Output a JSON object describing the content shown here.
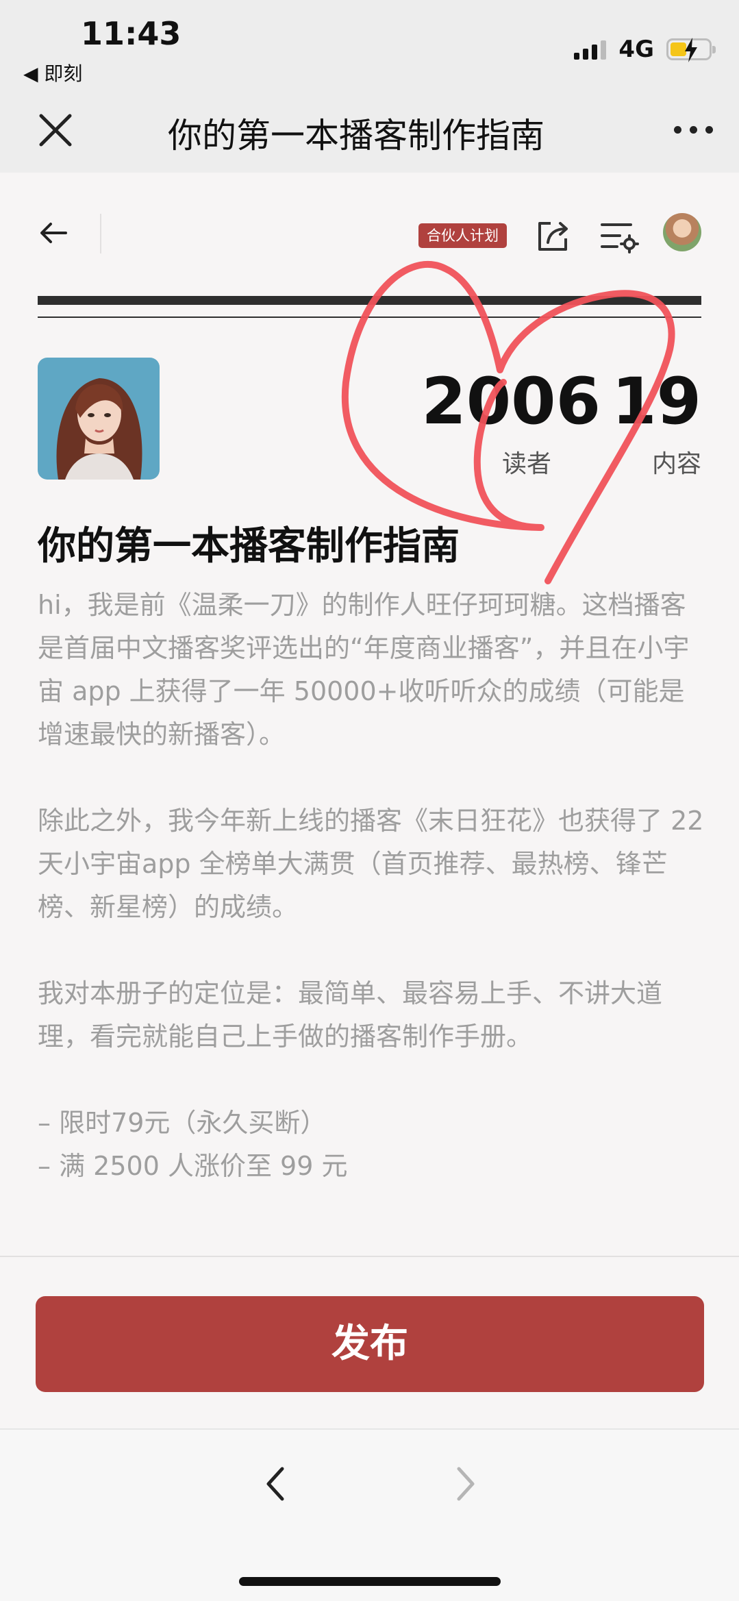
{
  "status_bar": {
    "time": "11:43",
    "back_app": "◀ 即刻",
    "network": "4G"
  },
  "nav": {
    "title": "你的第一本播客制作指南"
  },
  "toolbar": {
    "partner_badge": "合伙人计划"
  },
  "stats": {
    "readers_value": "2006",
    "readers_label": "读者",
    "items_value": "19",
    "items_label": "内容"
  },
  "book": {
    "title": "你的第一本播客制作指南",
    "description": [
      "hi，我是前《温柔一刀》的制作人旺仔珂珂糖。这档播客是首届中文播客奖评选出的“年度商业播客”，并且在小宇宙 app 上获得了一年 50000+收听听众的成绩（可能是增速最快的新播客）。",
      "除此之外，我今年新上线的播客《末日狂花》也获得了 22 天小宇宙app 全榜单大满贯（首页推荐、最热榜、锋芒榜、新星榜）的成绩。",
      "我对本册子的定位是：最简单、最容易上手、不讲大道理，看完就能自己上手做的播客制作手册。"
    ],
    "price_lines": [
      "– 限时79元（永久买断）",
      "– 满 2500 人涨价至 99 元"
    ]
  },
  "actions": {
    "publish": "发布"
  },
  "colors": {
    "accent": "#b0413e",
    "heart_annotation": "#f0525a",
    "description_text": "#9e9e9e"
  },
  "icons": [
    "close-icon",
    "more-icon",
    "back-arrow-icon",
    "share-icon",
    "settings-icon",
    "chevron-left-icon",
    "chevron-right-icon"
  ]
}
